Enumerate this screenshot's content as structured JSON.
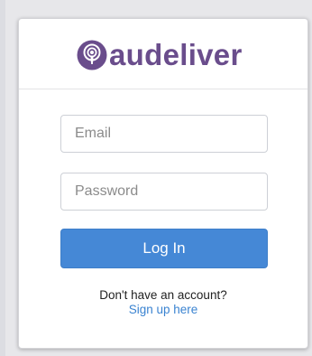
{
  "brand": {
    "name": "audeliver",
    "icon": "podcast-microphone-icon",
    "color": "#6a4d8c"
  },
  "form": {
    "email_placeholder": "Email",
    "password_placeholder": "Password",
    "login_label": "Log In",
    "login_color": "#4588d6"
  },
  "footer": {
    "no_account_text": "Don't have an account?",
    "signup_link": "Sign up here",
    "link_color": "#3a83d1"
  }
}
